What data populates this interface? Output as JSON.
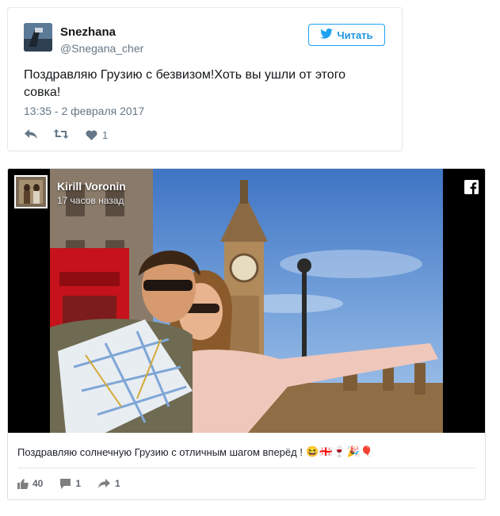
{
  "tweet": {
    "author_name": "Snezhana",
    "author_handle": "@Snegana_cher",
    "follow_label": "Читать",
    "text": "Поздравляю Грузию с безвизом!Хоть вы ушли от этого совка!",
    "timestamp": "13:35 - 2 февраля 2017",
    "likes": "1",
    "icons": [
      "twitter-bird-icon",
      "reply-icon",
      "retweet-icon",
      "heart-icon"
    ],
    "colors": {
      "accent": "#1da1f2",
      "meta": "#657786"
    }
  },
  "facebook_post": {
    "author_name": "Kirill Voronin",
    "time_ago": "17 часов назад",
    "text": "Поздравляю солнечную Грузию с отличным шагом вперёд !",
    "emojis": [
      "😆",
      "🇬🇪",
      "🍷",
      "🎉",
      "🎈"
    ],
    "likes": "40",
    "comments": "1",
    "shares": "1",
    "icons": [
      "facebook-logo-icon",
      "like-icon",
      "comment-icon",
      "share-icon"
    ]
  }
}
